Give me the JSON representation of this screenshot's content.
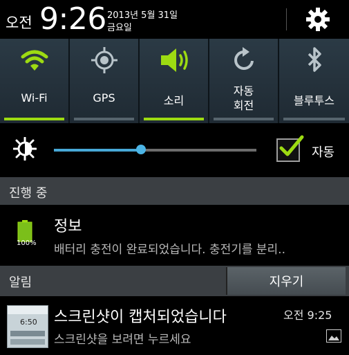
{
  "status": {
    "ampm": "오전",
    "time": "9:26",
    "date": "2013년 5월 31일",
    "weekday": "금요일",
    "settings_icon": "gear-icon"
  },
  "toggles": [
    {
      "label": "Wi-Fi",
      "icon": "wifi-icon",
      "on": true
    },
    {
      "label": "GPS",
      "icon": "gps-icon",
      "on": false
    },
    {
      "label": "소리",
      "icon": "sound-icon",
      "on": true
    },
    {
      "label": "자동\n회전",
      "icon": "rotate-icon",
      "on": false
    },
    {
      "label": "블루투스",
      "icon": "bluetooth-icon",
      "on": false
    }
  ],
  "brightness": {
    "level": 0.43,
    "auto_label": "자동",
    "auto_checked": true,
    "icon": "brightness-icon"
  },
  "ongoing": {
    "header": "진행 중",
    "item": {
      "title": "정보",
      "text": "배터리 충전이 완료되었습니다. 충전기를 분리..",
      "battery_pct": "100%",
      "icon": "battery-icon"
    }
  },
  "notifications": {
    "header": "알림",
    "clear_label": "지우기",
    "item": {
      "title": "스크린샷이 캡처되었습니다",
      "text": "스크린샷을 보려면 누르세요",
      "time": "오전 9:25",
      "thumb_time": "6:50",
      "icon": "gallery-icon"
    }
  },
  "colors": {
    "accent_on": "#9ddb12",
    "accent_off": "#56646d",
    "slider": "#47a8d6"
  }
}
